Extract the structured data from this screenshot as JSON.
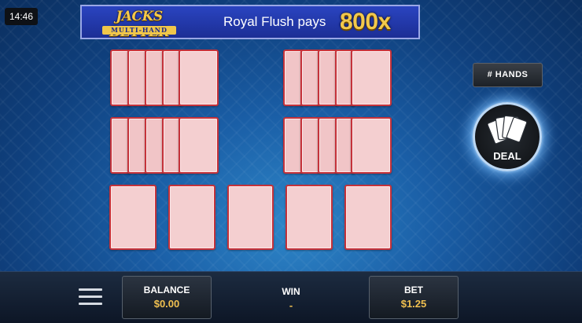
{
  "status": {
    "time": "14:46"
  },
  "header": {
    "logo_line1": "JACKS BETTER",
    "logo_line2": "MULTI-HAND",
    "pay_text": "Royal Flush pays",
    "pay_value": "800x"
  },
  "hands": {
    "rows": [
      {
        "name": "hand-row-1",
        "hands": 2,
        "cards_per_hand": 5,
        "face": "down"
      },
      {
        "name": "hand-row-2",
        "hands": 2,
        "cards_per_hand": 5,
        "face": "down"
      },
      {
        "name": "main-hand",
        "hands": 1,
        "cards_per_hand": 5,
        "face": "down"
      }
    ]
  },
  "controls": {
    "hands_button": "# HANDS",
    "deal_button": "DEAL",
    "deal_icon": "cards-fan-icon",
    "menu_icon": "hamburger-menu-icon"
  },
  "footer": {
    "balance_label": "BALANCE",
    "balance_value": "$0.00",
    "win_label": "WIN",
    "win_value": "-",
    "bet_label": "BET",
    "bet_value": "$1.25"
  },
  "colors": {
    "card_back": "#f4cfd0",
    "card_border": "#c5323a",
    "gold": "#f0c050",
    "banner_blue": "#1c2e95"
  }
}
